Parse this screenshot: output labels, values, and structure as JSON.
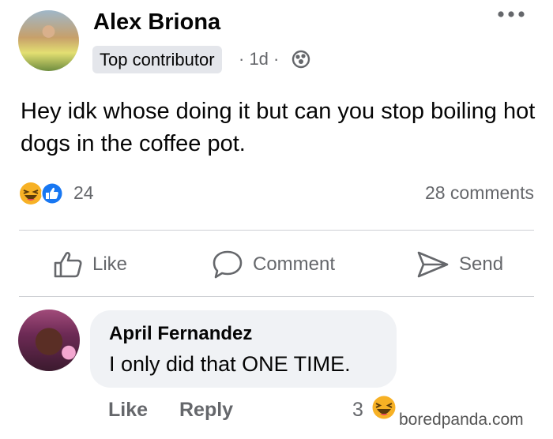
{
  "post": {
    "author": "Alex Briona",
    "badge": "Top contributor",
    "time": "· 1d ·",
    "text": "Hey idk whose doing it but can you stop boiling hot dogs in the coffee pot.",
    "reaction_count": "24",
    "comment_count": "28 comments"
  },
  "actions": {
    "like": "Like",
    "comment": "Comment",
    "send": "Send"
  },
  "comment": {
    "author": "April Fernandez",
    "text": "I only did that ONE TIME.",
    "like": "Like",
    "reply": "Reply",
    "reaction_count": "3"
  },
  "watermark": "boredpanda.com",
  "colors": {
    "primary_text": "#050505",
    "secondary_text": "#65676b",
    "badge_bg": "#e4e6eb",
    "bubble_bg": "#f0f2f5",
    "like_blue": "#1877f2",
    "haha_yellow": "#f7b125"
  },
  "icons": [
    "more-options-icon",
    "globe-icon",
    "haha-reaction-icon",
    "like-reaction-icon",
    "thumbs-up-icon",
    "comment-bubble-icon",
    "send-arrow-icon"
  ]
}
